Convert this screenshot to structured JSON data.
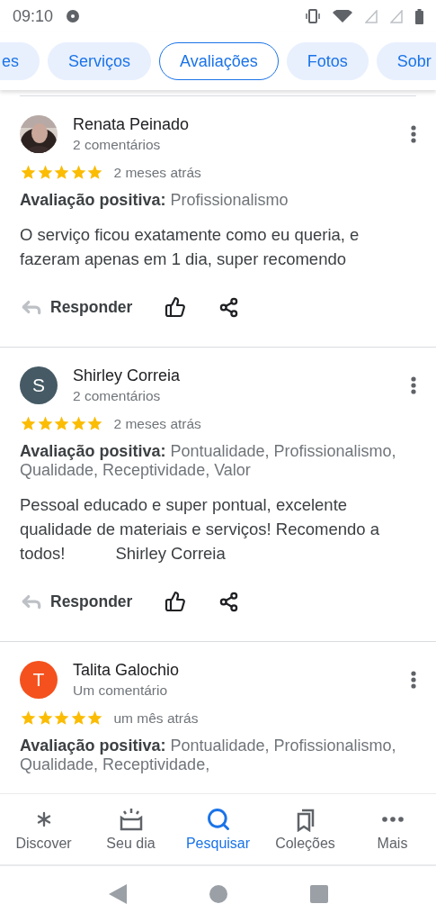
{
  "status_bar": {
    "time": "09:10"
  },
  "tabs": [
    {
      "label": "es",
      "selected": false
    },
    {
      "label": "Serviços",
      "selected": false
    },
    {
      "label": "Avaliações",
      "selected": true
    },
    {
      "label": "Fotos",
      "selected": false
    },
    {
      "label": "Sobr",
      "selected": false
    }
  ],
  "reviews": [
    {
      "name": "Renata Peinado",
      "comments": "2 comentários",
      "stars": 5,
      "time": "2 meses atrás",
      "positive_label": "Avaliação positiva:",
      "positive_values": "Profissionalismo",
      "body": "O serviço ficou exatamente como eu queria, e fazeram apenas em 1 dia, super recomendo",
      "reply": "Responder"
    },
    {
      "name": "Shirley Correia",
      "avatar": {
        "kind": "letter",
        "letter": "S",
        "color": "#455a64"
      },
      "comments": "2 comentários",
      "stars": 5,
      "time": "2 meses atrás",
      "positive_label": "Avaliação positiva:",
      "positive_values": "Pontualidade, Profissionalismo, Qualidade, Receptividade, Valor",
      "body": "Pessoal educado e super pontual, excelente qualidade de materiais e serviços! Recomendo a todos!",
      "signature": "Shirley Correia",
      "reply": "Responder"
    },
    {
      "name": "Talita Galochio",
      "avatar": {
        "kind": "letter",
        "letter": "T",
        "color": "#f4511e"
      },
      "comments": "Um comentário",
      "stars": 5,
      "time": "um mês atrás",
      "positive_label": "Avaliação positiva:",
      "positive_values": "Pontualidade, Profissionalismo, Qualidade, Receptividade,"
    }
  ],
  "bottom_nav": [
    {
      "label": "Discover",
      "selected": false
    },
    {
      "label": "Seu dia",
      "selected": false
    },
    {
      "label": "Pesquisar",
      "selected": true
    },
    {
      "label": "Coleções",
      "selected": false
    },
    {
      "label": "Mais",
      "selected": false
    }
  ]
}
